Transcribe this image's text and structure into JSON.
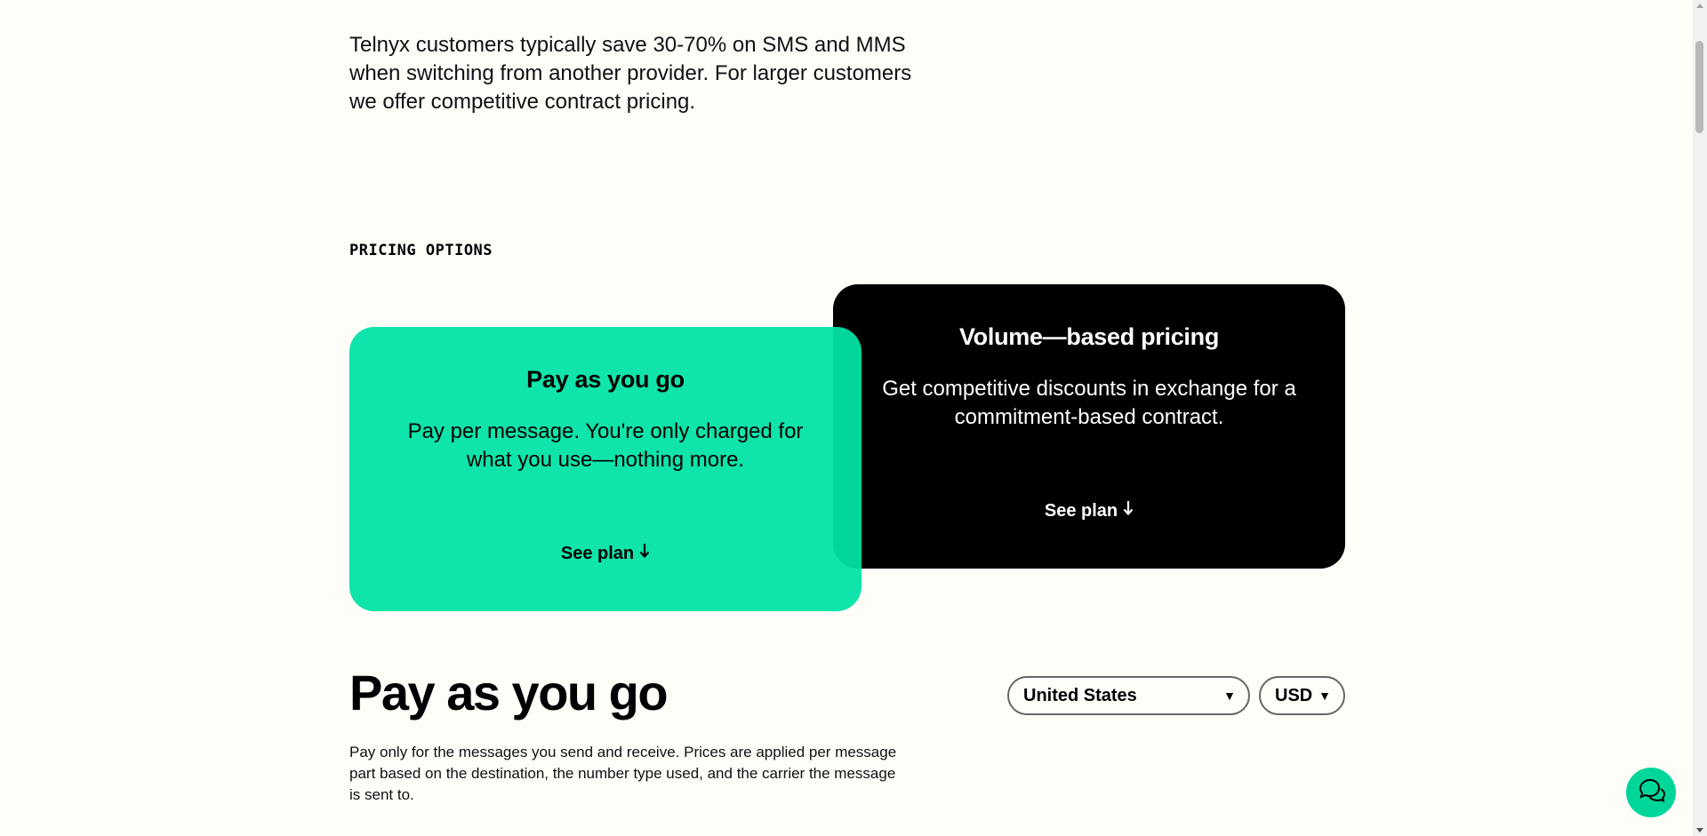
{
  "intro": {
    "text": "Telnyx customers typically save 30-70% on SMS and MMS when switching from another provider. For larger customers we offer competitive contract pricing."
  },
  "pricing_options": {
    "eyebrow": "PRICING OPTIONS",
    "cards": [
      {
        "title": "Volume—based pricing",
        "description": "Get competitive discounts in exchange for a commitment-based contract.",
        "link": "See plan",
        "background": "#000000"
      },
      {
        "title": "Pay as you go",
        "description": "Pay per message. You're only charged for what you use—nothing more.",
        "link": "See plan",
        "background": "#00e2a5"
      }
    ]
  },
  "pay_as_you_go": {
    "title": "Pay as you go",
    "country_select": "United States",
    "currency_select": "USD",
    "description": "Pay only for the messages you send and receive. Prices are applied per message part based on the destination, the number type used, and the carrier the message is sent to."
  },
  "icons": {
    "down_arrow": "arrow-down-icon",
    "caret": "caret-down-icon",
    "chat": "chat-bubbles-icon"
  }
}
